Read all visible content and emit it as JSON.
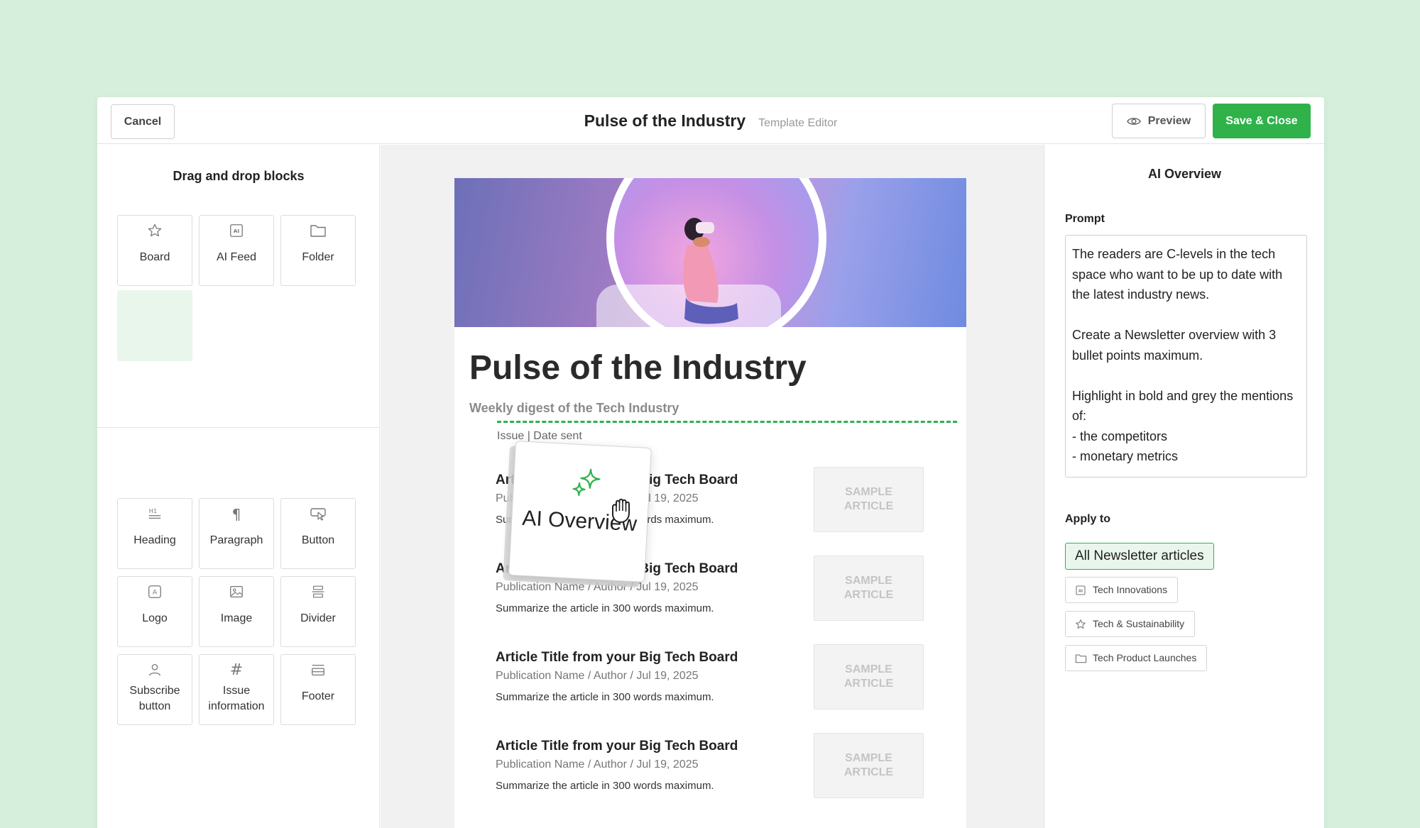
{
  "topbar": {
    "cancel_label": "Cancel",
    "title": "Pulse of the Industry",
    "subtitle": "Template Editor",
    "preview_label": "Preview",
    "save_label": "Save & Close"
  },
  "left": {
    "title": "Drag and drop blocks",
    "sources": [
      {
        "label": "Board",
        "icon": "star-icon"
      },
      {
        "label": "AI Feed",
        "icon": "ai-feed-icon"
      },
      {
        "label": "Folder",
        "icon": "folder-icon"
      }
    ],
    "blocks": [
      {
        "label": "Heading",
        "icon": "heading-icon"
      },
      {
        "label": "Paragraph",
        "icon": "paragraph-icon"
      },
      {
        "label": "Button",
        "icon": "button-icon"
      },
      {
        "label": "Logo",
        "icon": "logo-icon"
      },
      {
        "label": "Image",
        "icon": "image-icon"
      },
      {
        "label": "Divider",
        "icon": "divider-icon"
      },
      {
        "label": "Subscribe button",
        "icon": "user-icon"
      },
      {
        "label": "Issue information",
        "icon": "hash-icon"
      },
      {
        "label": "Footer",
        "icon": "footer-icon"
      }
    ]
  },
  "newsletter": {
    "title": "Pulse of the Industry",
    "subtitle": "Weekly digest of the Tech Industry",
    "meta": "Issue | Date sent",
    "articles": [
      {
        "title": "Article Title from your Big Tech Board",
        "meta": "Publication Name / Author / Jul 19, 2025",
        "summary": "Summarize the article in 300 words maximum.",
        "thumb": "SAMPLE ARTICLE"
      },
      {
        "title": "Article Title from your Big Tech Board",
        "meta": "Publication Name / Author / Jul 19, 2025",
        "summary": "Summarize the article in 300 words maximum.",
        "thumb": "SAMPLE ARTICLE"
      },
      {
        "title": "Article Title from your Big Tech Board",
        "meta": "Publication Name / Author / Jul 19, 2025",
        "summary": "Summarize the article in 300 words maximum.",
        "thumb": "SAMPLE ARTICLE"
      },
      {
        "title": "Article Title from your Big Tech Board",
        "meta": "Publication Name / Author / Jul 19, 2025",
        "summary": "Summarize the article in 300 words maximum.",
        "thumb": "SAMPLE ARTICLE"
      }
    ]
  },
  "drag": {
    "label": "AI Overview",
    "icon": "sparkle-icon",
    "cursor_icon": "grab-hand-icon"
  },
  "right": {
    "title": "AI Overview",
    "prompt_label": "Prompt",
    "prompt_text": "The readers are C-levels in the tech space who want to be up to date with the latest industry news.\n\nCreate a Newsletter overview with 3 bullet points maximum.\n\nHighlight in bold and grey the mentions of:\n- the competitors\n- monetary metrics",
    "apply_label": "Apply to",
    "apply_selected": "All Newsletter articles",
    "apply_options": [
      {
        "label": "Tech Innovations",
        "icon": "ai-feed-icon"
      },
      {
        "label": "Tech & Sustainability",
        "icon": "star-icon"
      },
      {
        "label": "Tech Product Launches",
        "icon": "folder-icon"
      }
    ]
  },
  "colors": {
    "accent": "#2fb24a",
    "page_bg": "#d6efdc",
    "canvas_bg": "#f1f1f1"
  }
}
